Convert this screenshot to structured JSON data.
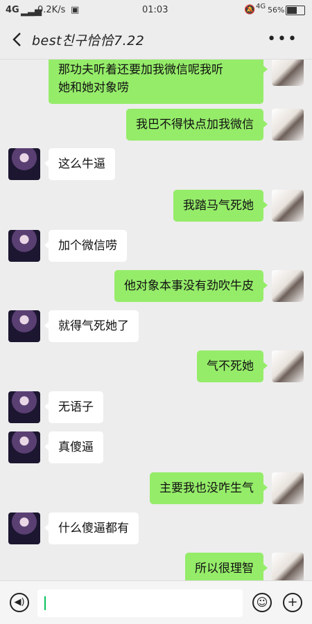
{
  "status_bar": {
    "network": "4G",
    "speed": "0.2K/s",
    "time": "01:03",
    "network_right": "4G",
    "battery": "56%"
  },
  "header": {
    "title": "best친구恰恰7.22"
  },
  "messages": [
    {
      "sender": "self",
      "text_lines": [
        "那功夫听着还要加我微信呢我听",
        "她和她对象唠"
      ]
    },
    {
      "sender": "self",
      "text_lines": [
        "我巴不得快点加我微信"
      ]
    },
    {
      "sender": "other",
      "text_lines": [
        "这么牛逼"
      ]
    },
    {
      "sender": "self",
      "text_lines": [
        "我踏马气死她"
      ]
    },
    {
      "sender": "other",
      "text_lines": [
        "加个微信唠"
      ]
    },
    {
      "sender": "self",
      "text_lines": [
        "他对象本事没有劲吹牛皮"
      ]
    },
    {
      "sender": "other",
      "text_lines": [
        "就得气死她了"
      ]
    },
    {
      "sender": "self",
      "text_lines": [
        "气不死她"
      ]
    },
    {
      "sender": "other",
      "text_lines": [
        "无语子"
      ]
    },
    {
      "sender": "other",
      "text_lines": [
        "真傻逼"
      ]
    },
    {
      "sender": "self",
      "text_lines": [
        "主要我也没咋生气"
      ]
    },
    {
      "sender": "other",
      "text_lines": [
        "什么傻逼都有"
      ]
    },
    {
      "sender": "self",
      "text_lines": [
        "所以很理智"
      ]
    }
  ],
  "input_bar": {
    "voice_icon": "voice-icon",
    "emoji_icon": "emoji-icon",
    "add_icon": "add-icon"
  }
}
